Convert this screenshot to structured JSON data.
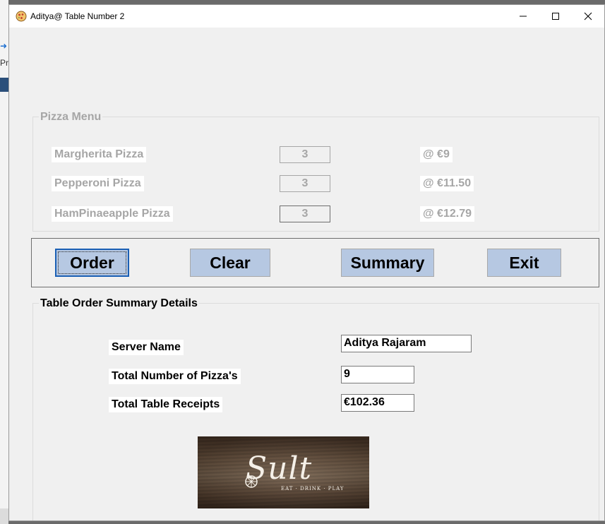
{
  "window": {
    "title": "Aditya@ Table Number 2"
  },
  "background_app": {
    "fragment_label": "Pro"
  },
  "pizza_menu": {
    "legend": "Pizza Menu",
    "items": [
      {
        "name": "Margherita Pizza",
        "quantity": "3",
        "price": "@ €9"
      },
      {
        "name": "Pepperoni Pizza",
        "quantity": "3",
        "price": "@ €11.50"
      },
      {
        "name": "HamPinaeapple Pizza",
        "quantity": "3",
        "price": "@ €12.79"
      }
    ]
  },
  "buttons": {
    "order": "Order",
    "clear": "Clear",
    "summary": "Summary",
    "exit": "Exit"
  },
  "summary": {
    "legend": "Table Order Summary Details",
    "server_name_label": "Server Name",
    "server_name_value": "Aditya Rajaram",
    "total_pizzas_label": "Total Number of Pizza's",
    "total_pizzas_value": "9",
    "total_receipts_label": "Total Table  Receipts",
    "total_receipts_value": "€102.36"
  },
  "logo": {
    "wordmark": "Sult",
    "tagline": "EAT · DRINK · PLAY"
  },
  "icons": {
    "app": "pizza-app-icon",
    "minimize": "minimize-icon",
    "maximize": "maximize-icon",
    "close": "close-icon"
  },
  "colors": {
    "button_fill": "#b6c8e2",
    "disabled_text": "#a6a6a6",
    "focus_border": "#1a5fb4"
  }
}
